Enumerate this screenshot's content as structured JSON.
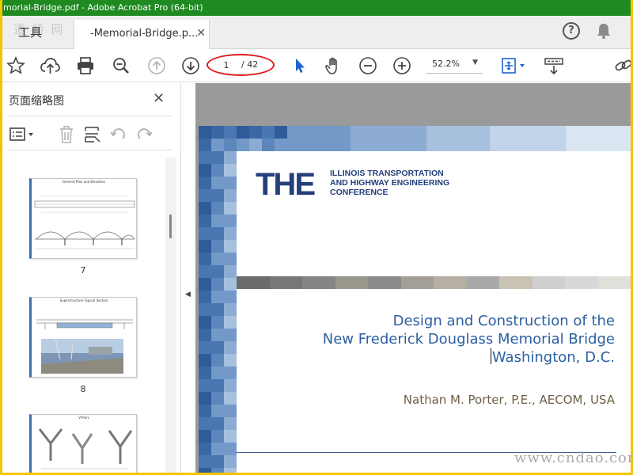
{
  "window": {
    "title": "morial-Bridge.pdf - Adobe Acrobat Pro (64-bit)"
  },
  "watermarks": {
    "top_left": "道 桥 网",
    "bottom_right": "www.cndao.com"
  },
  "tabs": {
    "tools_label": "工具",
    "document_label": "-Memorial-Bridge.p...",
    "close_glyph": "✕"
  },
  "toolbar": {
    "page_current": "1",
    "page_total": "/ 42",
    "zoom": "52.2%",
    "zoom_arrow": "▼"
  },
  "sidebar": {
    "title": "页面缩略图",
    "close_glyph": "✕",
    "thumbnails": [
      {
        "caption": "General Plan and Elevation",
        "number": "7"
      },
      {
        "caption": "Superstructure Typical Section",
        "number": "8"
      },
      {
        "caption": "V-Piers",
        "number": ""
      }
    ]
  },
  "slide": {
    "logo_text": "THE",
    "logo_sub": [
      "ILLINOIS TRANSPORTATION",
      "AND HIGHWAY ENGINEERING",
      "CONFERENCE"
    ],
    "title_lines": [
      "Design and Construction of the",
      "New Frederick Douglass Memorial Bridge",
      "Washington, D.C."
    ],
    "author": "Nathan M. Porter, P.E., AECOM, USA"
  },
  "colors": {
    "titlebar": "#1f8a21",
    "accent_blue": "#2b5fa1",
    "logo_navy": "#243f7c",
    "highlight_red": "#e0181b",
    "frame_yellow": "#f4c400"
  }
}
